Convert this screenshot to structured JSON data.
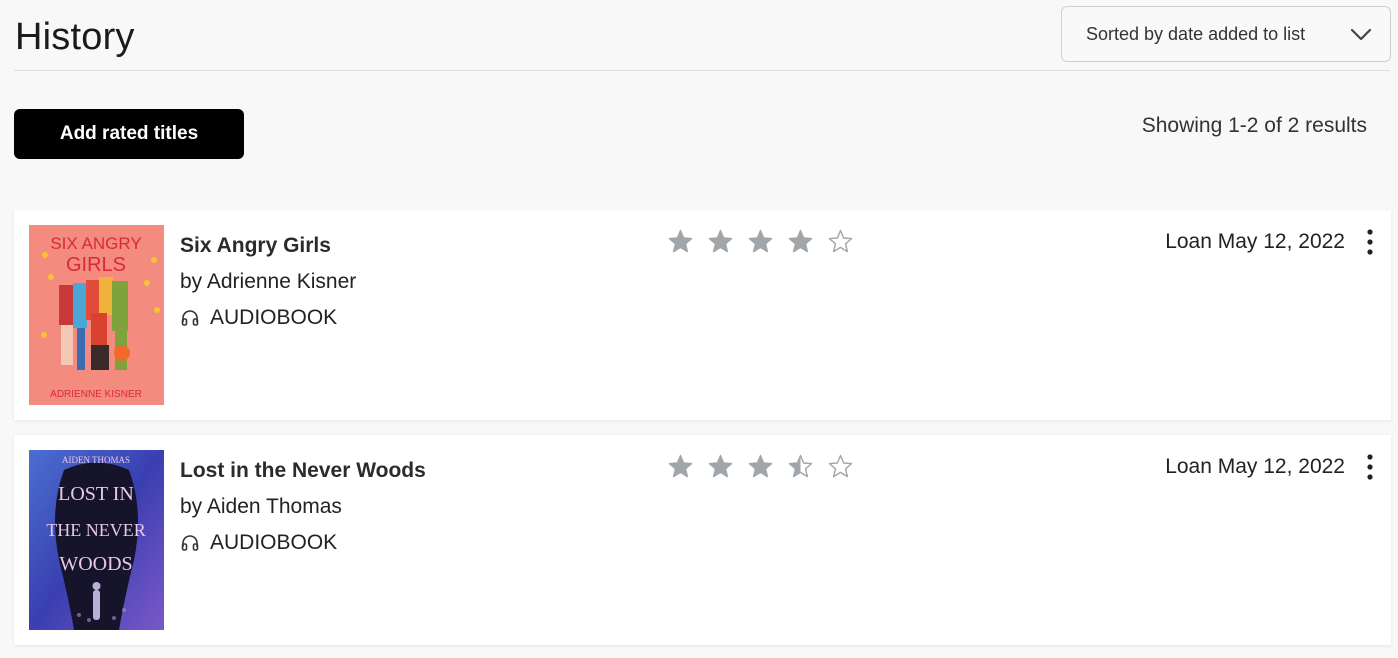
{
  "header": {
    "title": "History",
    "sort_label": "Sorted by date added to list",
    "sort_icon": "chevron-down-icon"
  },
  "toolbar": {
    "add_rated_label": "Add rated titles",
    "results_text": "Showing 1-2 of 2 results"
  },
  "colors": {
    "star_fill": "#a1a6ab",
    "button_bg": "#000000"
  },
  "items": [
    {
      "title": "Six Angry Girls",
      "author": "by Adrienne Kisner",
      "format": "AUDIOBOOK",
      "format_icon": "headphones-icon",
      "rating": 4,
      "rating_max": 5,
      "loan": "Loan May 12, 2022",
      "cover": {
        "title_line1": "SIX ANGRY",
        "title_line2": "GIRLS",
        "author": "ADRIENNE KISNER",
        "bg": "#f38b7e",
        "text_color": "#d92a3a"
      }
    },
    {
      "title": "Lost in the Never Woods",
      "author": "by Aiden Thomas",
      "format": "AUDIOBOOK",
      "format_icon": "headphones-icon",
      "rating": 3.5,
      "rating_max": 5,
      "loan": "Loan May 12, 2022",
      "cover": {
        "author": "AIDEN THOMAS",
        "title_line1": "LOST IN",
        "title_line2": "THE NEVER",
        "title_line3": "WOODS",
        "bg": "#3a46b8",
        "text_color": "#e9c8e8"
      }
    }
  ]
}
